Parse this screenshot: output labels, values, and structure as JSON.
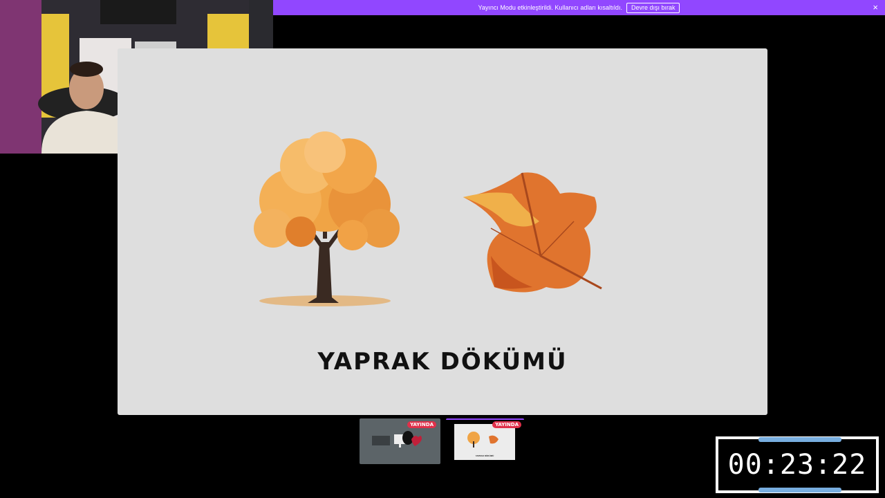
{
  "banner": {
    "message": "Yayıncı Modu etkinleştirildi. Kullanıcı adları kısaltıldı.",
    "disable_label": "Devre dışı bırak",
    "close_icon": "×"
  },
  "slide": {
    "title": "YAPRAK DÖKÜMÜ"
  },
  "thumbnails": [
    {
      "badge": "YAYINDA"
    },
    {
      "badge": "YAYINDA",
      "title": "YAPRAK DÖKÜMÜ"
    }
  ],
  "timer": {
    "value": "00:23:22"
  },
  "colors": {
    "banner": "#9147ff",
    "live_badge": "#e0304a",
    "timer_bar": "#78aee0"
  }
}
